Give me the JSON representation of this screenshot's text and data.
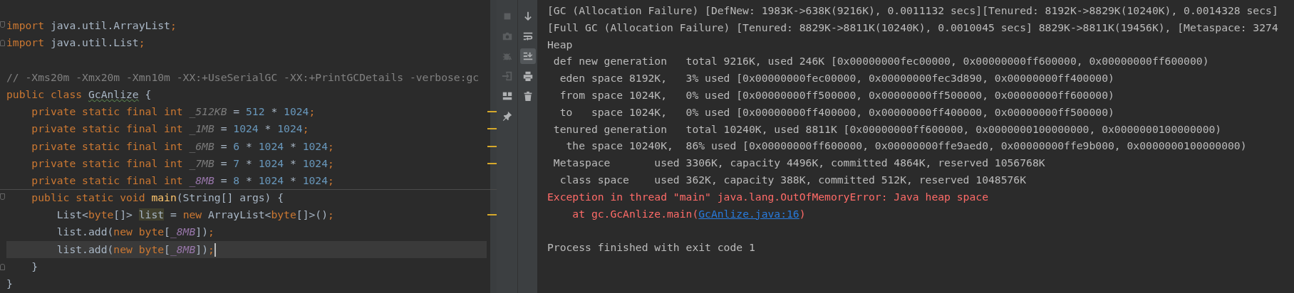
{
  "editor": {
    "lines": [
      {
        "current": false
      },
      {
        "current": false,
        "fold_start": true,
        "tokens": [
          {
            "kind": "keyword",
            "text": "import"
          },
          {
            "kind": "plain",
            "text": " java.util.ArrayList"
          },
          {
            "kind": "keyword",
            "text": ";"
          }
        ]
      },
      {
        "current": false,
        "fold_end": true,
        "tokens": [
          {
            "kind": "keyword",
            "text": "import"
          },
          {
            "kind": "plain",
            "text": " java.util.List"
          },
          {
            "kind": "keyword",
            "text": ";"
          }
        ]
      },
      {
        "current": false
      },
      {
        "current": false,
        "tokens": [
          {
            "kind": "comment",
            "text": "// -Xms20m -Xmx20m -Xmn10m -XX:+UseSerialGC -XX:+PrintGCDetails -verbose:gc"
          }
        ]
      },
      {
        "current": false,
        "tokens": [
          {
            "kind": "keyword",
            "text": "public class "
          },
          {
            "kind": "typo",
            "text": "GcAnlize"
          },
          {
            "kind": "plain",
            "text": " {"
          }
        ]
      },
      {
        "current": false,
        "warning": true,
        "tokens": [
          {
            "kind": "keyword",
            "text": "    private static final int "
          },
          {
            "kind": "unused_field",
            "text": "_512KB"
          },
          {
            "kind": "plain",
            "text": " = "
          },
          {
            "kind": "number",
            "text": "512"
          },
          {
            "kind": "plain",
            "text": " * "
          },
          {
            "kind": "number",
            "text": "1024"
          },
          {
            "kind": "keyword",
            "text": ";"
          }
        ]
      },
      {
        "current": false,
        "warning": true,
        "tokens": [
          {
            "kind": "keyword",
            "text": "    private static final int "
          },
          {
            "kind": "unused_field",
            "text": "_1MB"
          },
          {
            "kind": "plain",
            "text": " = "
          },
          {
            "kind": "number",
            "text": "1024"
          },
          {
            "kind": "plain",
            "text": " * "
          },
          {
            "kind": "number",
            "text": "1024"
          },
          {
            "kind": "keyword",
            "text": ";"
          }
        ]
      },
      {
        "current": false,
        "warning": true,
        "tokens": [
          {
            "kind": "keyword",
            "text": "    private static final int "
          },
          {
            "kind": "unused_field",
            "text": "_6MB"
          },
          {
            "kind": "plain",
            "text": " = "
          },
          {
            "kind": "number",
            "text": "6"
          },
          {
            "kind": "plain",
            "text": " * "
          },
          {
            "kind": "number",
            "text": "1024"
          },
          {
            "kind": "plain",
            "text": " * "
          },
          {
            "kind": "number",
            "text": "1024"
          },
          {
            "kind": "keyword",
            "text": ";"
          }
        ]
      },
      {
        "current": false,
        "warning": true,
        "tokens": [
          {
            "kind": "keyword",
            "text": "    private static final int "
          },
          {
            "kind": "unused_field",
            "text": "_7MB"
          },
          {
            "kind": "plain",
            "text": " = "
          },
          {
            "kind": "number",
            "text": "7"
          },
          {
            "kind": "plain",
            "text": " * "
          },
          {
            "kind": "number",
            "text": "1024"
          },
          {
            "kind": "plain",
            "text": " * "
          },
          {
            "kind": "number",
            "text": "1024"
          },
          {
            "kind": "keyword",
            "text": ";"
          }
        ]
      },
      {
        "current": false,
        "tokens": [
          {
            "kind": "keyword",
            "text": "    private static final int "
          },
          {
            "kind": "field",
            "text": "_8MB"
          },
          {
            "kind": "plain",
            "text": " = "
          },
          {
            "kind": "number",
            "text": "8"
          },
          {
            "kind": "plain",
            "text": " * "
          },
          {
            "kind": "number",
            "text": "1024"
          },
          {
            "kind": "plain",
            "text": " * "
          },
          {
            "kind": "number",
            "text": "1024"
          },
          {
            "kind": "keyword",
            "text": ";"
          }
        ]
      },
      {
        "current": false,
        "divider": true,
        "fold_start": true,
        "tokens": [
          {
            "kind": "keyword",
            "text": "    public static void "
          },
          {
            "kind": "method",
            "text": "main"
          },
          {
            "kind": "plain",
            "text": "(String[] args) {"
          }
        ]
      },
      {
        "current": false,
        "warning": true,
        "tokens": [
          {
            "kind": "plain",
            "text": "        List<"
          },
          {
            "kind": "keyword",
            "text": "byte"
          },
          {
            "kind": "plain",
            "text": "[]> "
          },
          {
            "kind": "usage",
            "text": "list"
          },
          {
            "kind": "plain",
            "text": " = "
          },
          {
            "kind": "keyword",
            "text": "new "
          },
          {
            "kind": "plain",
            "text": "ArrayList<"
          },
          {
            "kind": "keyword",
            "text": "byte"
          },
          {
            "kind": "plain",
            "text": "[]>()"
          },
          {
            "kind": "keyword",
            "text": ";"
          }
        ]
      },
      {
        "current": false,
        "tokens": [
          {
            "kind": "plain",
            "text": "        list.add("
          },
          {
            "kind": "keyword",
            "text": "new "
          },
          {
            "kind": "keyword",
            "text": "byte"
          },
          {
            "kind": "plain",
            "text": "["
          },
          {
            "kind": "field",
            "text": "_8MB"
          },
          {
            "kind": "plain",
            "text": "])"
          },
          {
            "kind": "keyword",
            "text": ";"
          }
        ]
      },
      {
        "current": true,
        "tokens": [
          {
            "kind": "plain",
            "text": "        list.add("
          },
          {
            "kind": "keyword",
            "text": "new "
          },
          {
            "kind": "keyword",
            "text": "byte"
          },
          {
            "kind": "plain",
            "text": "["
          },
          {
            "kind": "field",
            "text": "_8MB"
          },
          {
            "kind": "plain",
            "text": "])"
          },
          {
            "kind": "keyword",
            "text": ";"
          }
        ]
      },
      {
        "current": false,
        "fold_end": true,
        "tokens": [
          {
            "kind": "plain",
            "text": "    }"
          }
        ]
      },
      {
        "current": false,
        "tokens": [
          {
            "kind": "plain",
            "text": "}"
          }
        ]
      }
    ]
  },
  "console_toolbar": {
    "columns": [
      [
        {
          "kind": "stop",
          "disabled": true
        },
        {
          "kind": "camera",
          "disabled": true
        },
        {
          "kind": "bug",
          "disabled": true
        },
        {
          "kind": "enter",
          "disabled": true
        },
        {
          "kind": "layout",
          "disabled": false
        },
        {
          "kind": "pin",
          "disabled": false
        }
      ],
      [
        {
          "kind": "down",
          "selected": false
        },
        {
          "kind": "wrap",
          "selected": false
        },
        {
          "kind": "scroll_end",
          "selected": true
        },
        {
          "kind": "print",
          "selected": false
        },
        {
          "kind": "trash",
          "selected": false
        }
      ]
    ]
  },
  "console": {
    "lines": [
      {
        "kind": "normal",
        "text": "[GC (Allocation Failure) [DefNew: 1983K->638K(9216K), 0.0011132 secs][Tenured: 8192K->8829K(10240K), 0.0014328 secs]"
      },
      {
        "kind": "normal",
        "text": "[Full GC (Allocation Failure) [Tenured: 8829K->8811K(10240K), 0.0010045 secs] 8829K->8811K(19456K), [Metaspace: 3274"
      },
      {
        "kind": "normal",
        "text": "Heap"
      },
      {
        "kind": "normal",
        "text": " def new generation   total 9216K, used 246K [0x00000000fec00000, 0x00000000ff600000, 0x00000000ff600000)"
      },
      {
        "kind": "normal",
        "text": "  eden space 8192K,   3% used [0x00000000fec00000, 0x00000000fec3d890, 0x00000000ff400000)"
      },
      {
        "kind": "normal",
        "text": "  from space 1024K,   0% used [0x00000000ff500000, 0x00000000ff500000, 0x00000000ff600000)"
      },
      {
        "kind": "normal",
        "text": "  to   space 1024K,   0% used [0x00000000ff400000, 0x00000000ff400000, 0x00000000ff500000)"
      },
      {
        "kind": "normal",
        "text": " tenured generation   total 10240K, used 8811K [0x00000000ff600000, 0x0000000100000000, 0x0000000100000000)"
      },
      {
        "kind": "normal",
        "text": "   the space 10240K,  86% used [0x00000000ff600000, 0x00000000ffe9aed0, 0x00000000ffe9b000, 0x0000000100000000)"
      },
      {
        "kind": "normal",
        "text": " Metaspace       used 3306K, capacity 4496K, committed 4864K, reserved 1056768K"
      },
      {
        "kind": "normal",
        "text": "  class space    used 362K, capacity 388K, committed 512K, reserved 1048576K"
      },
      {
        "kind": "error",
        "text": "Exception in thread \"main\" java.lang.OutOfMemoryError: Java heap space"
      },
      {
        "kind": "error",
        "text": "    at gc.GcAnlize.main(",
        "link": "GcAnlize.java:16",
        "suffix": ")"
      },
      {
        "kind": "blank"
      },
      {
        "kind": "normal",
        "text": "Process finished with exit code 1"
      }
    ]
  }
}
